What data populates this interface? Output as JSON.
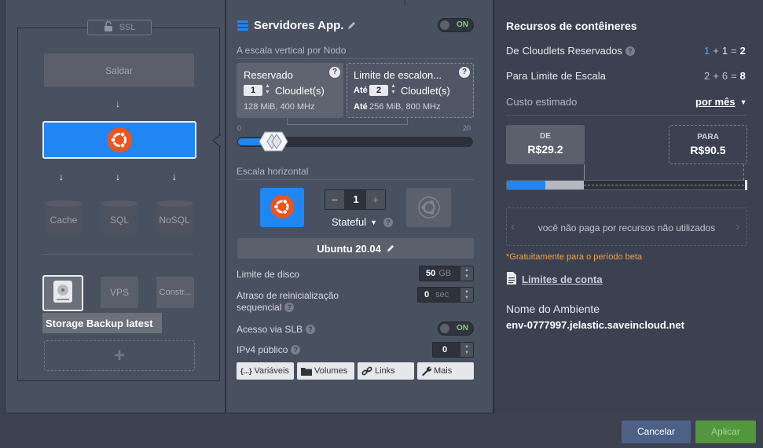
{
  "topology": {
    "ssl_label": "SSL",
    "balancer_label": "Saldar",
    "db_nodes": [
      "Cache",
      "SQL",
      "NoSQL"
    ],
    "extra_nodes": [
      "VPS",
      "Constr..."
    ],
    "storage_label": "Storage Backup latest",
    "add_symbol": "+",
    "arrow_glyph": "↓"
  },
  "config": {
    "title": "Servidores App.",
    "power_toggle": "ON",
    "vertical_title": "A escala vertical por Nodo",
    "reserved": {
      "title": "Reservado",
      "value": "1",
      "unit": "Cloudlet(s)",
      "info": "128 MiB, 400 MHz"
    },
    "limit": {
      "title": "Limite de escalon...",
      "prefix": "Até",
      "value": "2",
      "unit": "Cloudlet(s)",
      "info_prefix": "Até",
      "info": "256 MiB, 800 MHz"
    },
    "slider": {
      "min": "0",
      "max": "20",
      "reserved_fraction": 0.05,
      "limit_fraction": 0.1
    },
    "horizontal_title": "Escala horizontal",
    "count": "1",
    "minus": "−",
    "plus": "+",
    "stateful_label": "Stateful",
    "os_label": "Ubuntu 20.04",
    "disk_label": "Limite de disco",
    "disk_value": "50",
    "disk_unit": "GB",
    "restart_label_1": "Atraso de reinicialização",
    "restart_label_2": "sequencial",
    "restart_value": "0",
    "restart_unit": "sec",
    "slb_label": "Acesso via SLB",
    "slb_toggle": "ON",
    "ipv4_label": "IPv4 público",
    "ipv4_value": "0",
    "tabs": [
      "Variáveis",
      "Volumes",
      "Links",
      "Mais"
    ],
    "vars_glyph": "{...}"
  },
  "resources": {
    "title": "Recursos de contêineres",
    "reserved_label_a": "De",
    "reserved_label_b": "Cloudlets Reservados",
    "reserved_a": "1",
    "reserved_b": "1",
    "reserved_total": "2",
    "limit_label_a": "Para",
    "limit_label_b": "Limite de Escala",
    "limit_a": "2",
    "limit_b": "6",
    "limit_total": "8",
    "plus": "+",
    "equals": "=",
    "cost_label": "Custo estimado",
    "period": "por mês",
    "from_label": "DE",
    "from_price": "R$29.2",
    "to_label": "PARA",
    "to_price": "R$90.5",
    "cost_fraction": 0.16,
    "reserved_cost_fraction": 0.32,
    "unused_note": "você não paga por recursos não utilizados",
    "beta_note": "*Gratuitamente para o período beta",
    "account_link": "Limites de conta",
    "env_label": "Nome do Ambiente",
    "env_name": "env-0777997.jelastic.saveincloud.net"
  },
  "footer": {
    "cancel": "Cancelar",
    "apply": "Aplicar"
  },
  "colors": {
    "accent": "#1f86f4",
    "on_green": "#7fd16d",
    "beta_orange": "#f5a142",
    "apply_green": "#52963e",
    "cancel_blue": "#4d6187",
    "ubuntu": "#e95420"
  }
}
